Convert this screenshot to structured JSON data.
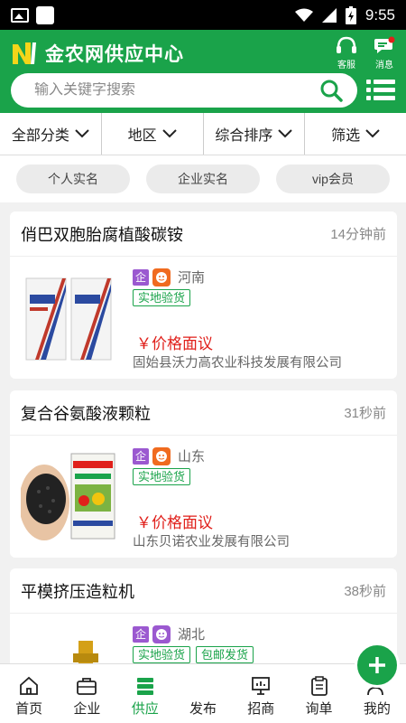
{
  "status_bar": {
    "time": "9:55"
  },
  "header": {
    "app_title": "金农网供应中心",
    "service_label": "客服",
    "message_label": "消息",
    "search_placeholder": "输入关键字搜索"
  },
  "filters": [
    {
      "label": "全部分类"
    },
    {
      "label": "地区"
    },
    {
      "label": "综合排序"
    },
    {
      "label": "筛选"
    }
  ],
  "chips": [
    {
      "label": "个人实名"
    },
    {
      "label": "企业实名"
    },
    {
      "label": "vip会员"
    }
  ],
  "listings": [
    {
      "title": "俏巴双胞胎腐植酸碳铵",
      "time": "14分钟前",
      "enterprise_tag": "企",
      "region": "河南",
      "verify": "实地验货",
      "price": "￥价格面议",
      "company": "固始县沃力高农业科技发展有限公司"
    },
    {
      "title": "复合谷氨酸液颗粒",
      "time": "31秒前",
      "enterprise_tag": "企",
      "region": "山东",
      "verify": "实地验货",
      "price": "￥价格面议",
      "company": "山东贝诺农业发展有限公司"
    },
    {
      "title": "平模挤压造粒机",
      "time": "38秒前",
      "enterprise_tag": "企",
      "region": "湖北",
      "verify": "实地验货",
      "verify2": "包邮发货"
    }
  ],
  "nav": {
    "home": "首页",
    "enterprise": "企业",
    "supply": "供应",
    "publish": "发布",
    "recruit": "招商",
    "inquiry": "询单",
    "mine": "我的"
  },
  "colors": {
    "brand_green": "#1aa34a",
    "price_red": "#e0201b",
    "vip_purple": "#9b59d0",
    "orange": "#f06b1f"
  }
}
